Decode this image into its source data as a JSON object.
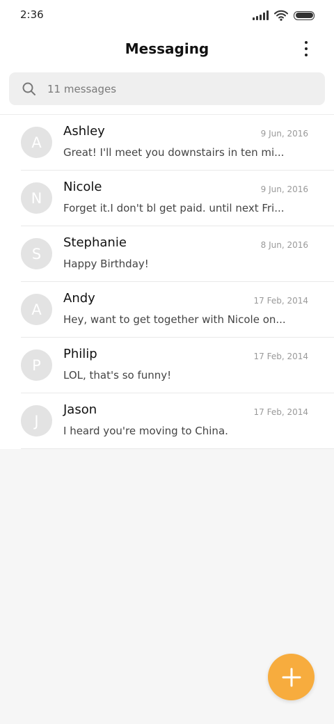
{
  "status_bar": {
    "time": "2:36"
  },
  "header": {
    "title": "Messaging"
  },
  "search": {
    "placeholder": "11 messages"
  },
  "messages": [
    {
      "initial": "A",
      "name": "Ashley",
      "date": "9 Jun, 2016",
      "preview": "Great! I'll meet you downstairs in ten mi..."
    },
    {
      "initial": "N",
      "name": "Nicole",
      "date": "9 Jun, 2016",
      "preview": "Forget it.I don't bl get paid. until next Fri..."
    },
    {
      "initial": "S",
      "name": "Stephanie",
      "date": "8 Jun, 2016",
      "preview": "Happy Birthday!"
    },
    {
      "initial": "A",
      "name": "Andy",
      "date": "17 Feb, 2014",
      "preview": "Hey, want to get together with Nicole on..."
    },
    {
      "initial": "P",
      "name": "Philip",
      "date": "17 Feb, 2014",
      "preview": "LOL, that's so funny!"
    },
    {
      "initial": "J",
      "name": "Jason",
      "date": "17 Feb, 2014",
      "preview": "I heard you're moving to China."
    }
  ],
  "colors": {
    "accent": "#f7ac3e",
    "avatar_bg": "#e3e3e3",
    "background": "#f6f6f6",
    "search_bg": "#efefef"
  },
  "icons": {
    "status": [
      "signal-icon",
      "wifi-icon",
      "battery-icon"
    ],
    "header": "more-vertical-icon",
    "search": "search-icon",
    "fab": "plus-icon"
  }
}
